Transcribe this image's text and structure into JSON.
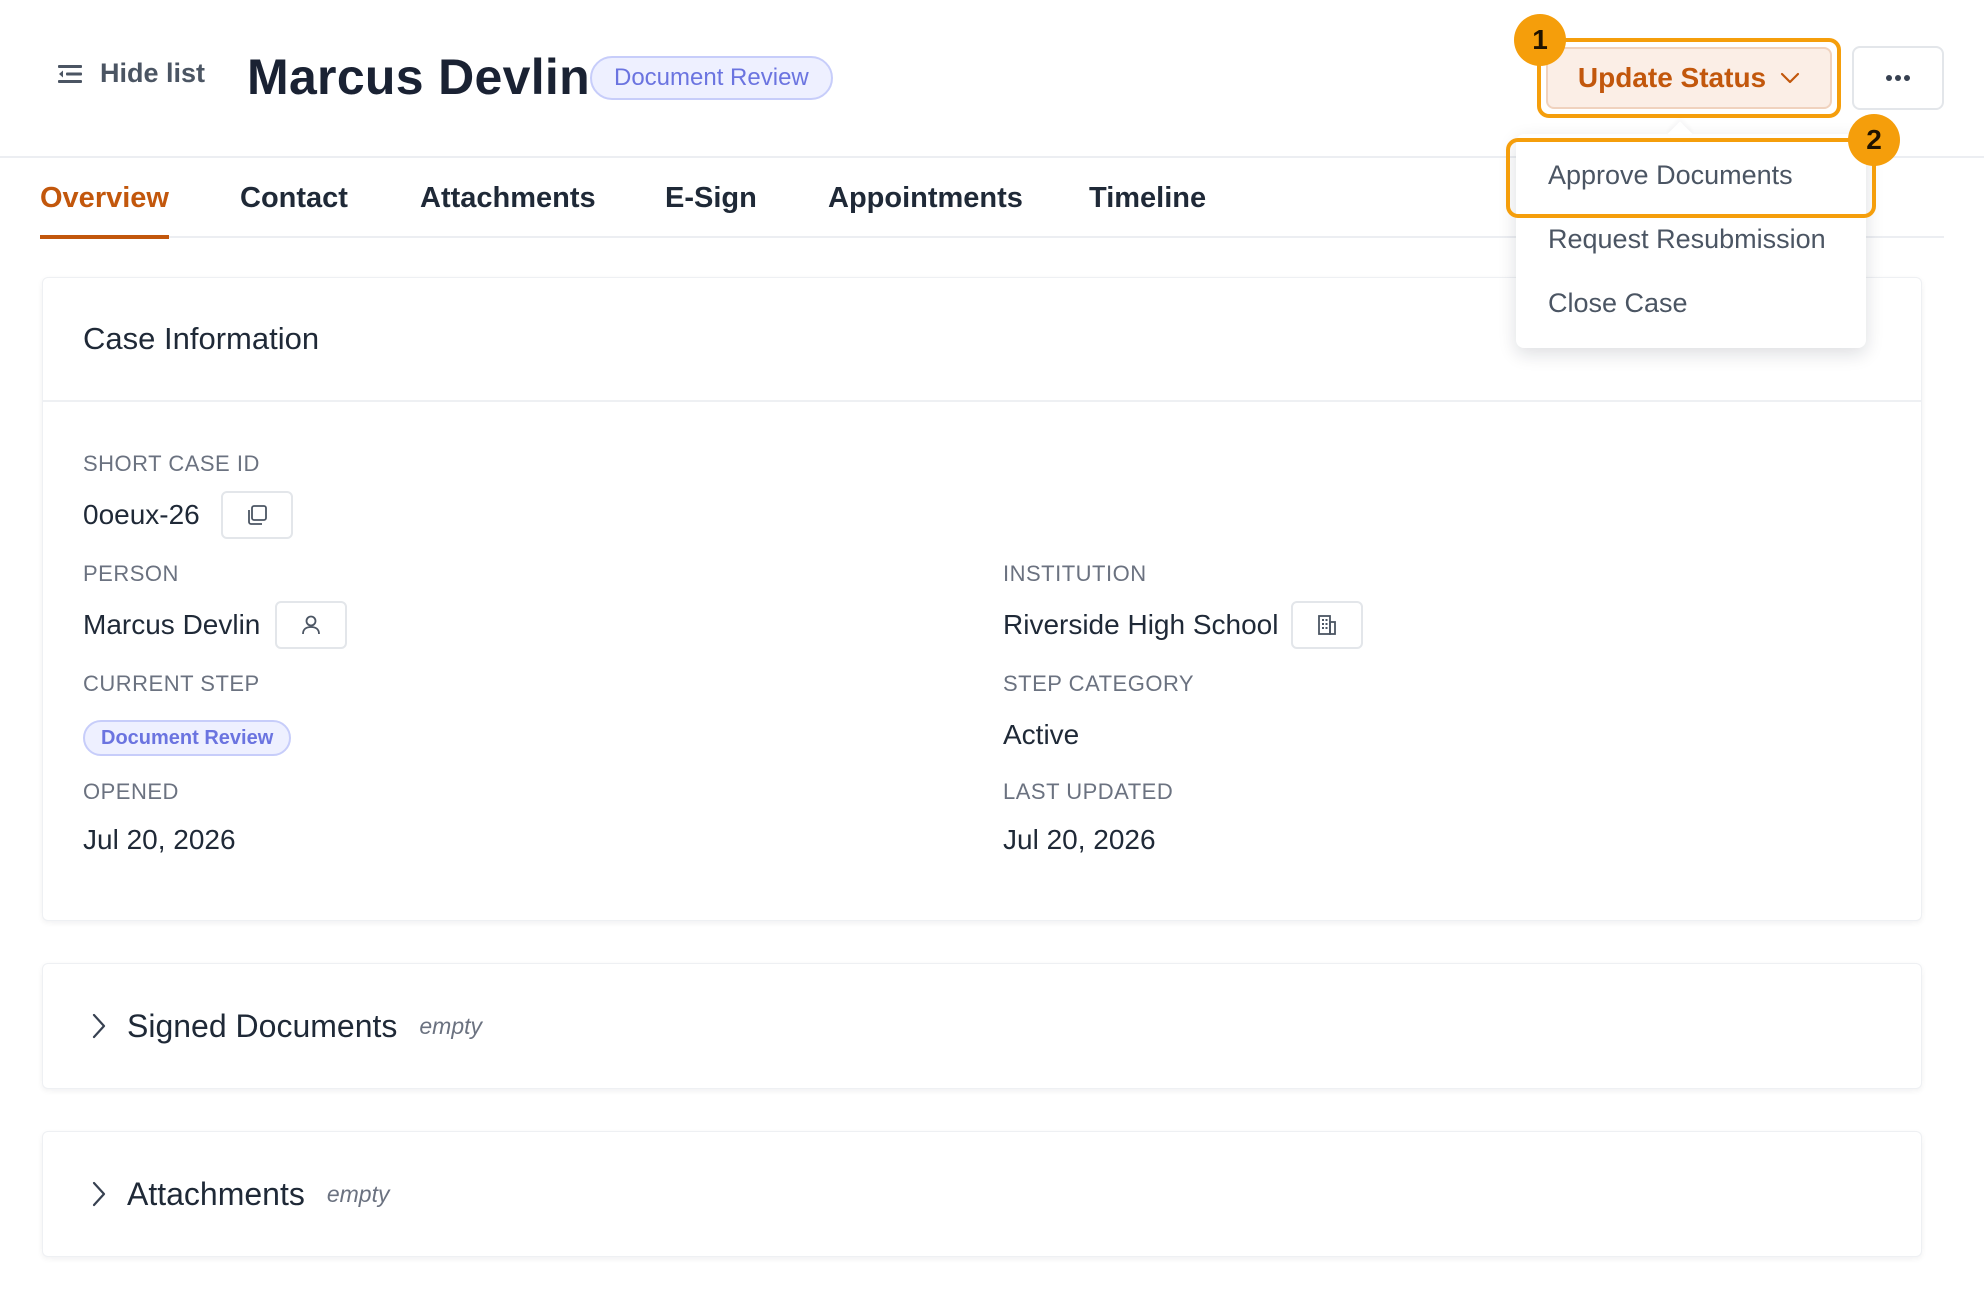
{
  "header": {
    "hide_list_label": "Hide list",
    "case_title": "Marcus Devlin",
    "status_badge": "Document Review",
    "update_status_label": "Update Status",
    "markers": [
      "1",
      "2"
    ]
  },
  "tabs": [
    {
      "label": "Overview",
      "active": true
    },
    {
      "label": "Contact"
    },
    {
      "label": "Attachments"
    },
    {
      "label": "E-Sign"
    },
    {
      "label": "Appointments"
    },
    {
      "label": "Timeline"
    }
  ],
  "status_menu": {
    "items": [
      "Approve Documents",
      "Request Resubmission",
      "Close Case"
    ]
  },
  "case_info": {
    "title": "Case Information",
    "short_case_id_label": "SHORT CASE ID",
    "short_case_id": "0oeux-26",
    "person_label": "PERSON",
    "person": "Marcus Devlin",
    "institution_label": "INSTITUTION",
    "institution": "Riverside High School",
    "current_step_label": "CURRENT STEP",
    "current_step": "Document Review",
    "step_category_label": "STEP CATEGORY",
    "step_category": "Active",
    "opened_label": "OPENED",
    "opened": "Jul 20, 2026",
    "last_updated_label": "LAST UPDATED",
    "last_updated": "Jul 20, 2026"
  },
  "sections": [
    {
      "title": "Signed Documents",
      "state": "empty"
    },
    {
      "title": "Attachments",
      "state": "empty"
    }
  ],
  "colors": {
    "accent": "#c2570c",
    "highlight": "#f59e0b",
    "badge_text": "#6b74e0",
    "badge_bg": "#eef0ff"
  }
}
